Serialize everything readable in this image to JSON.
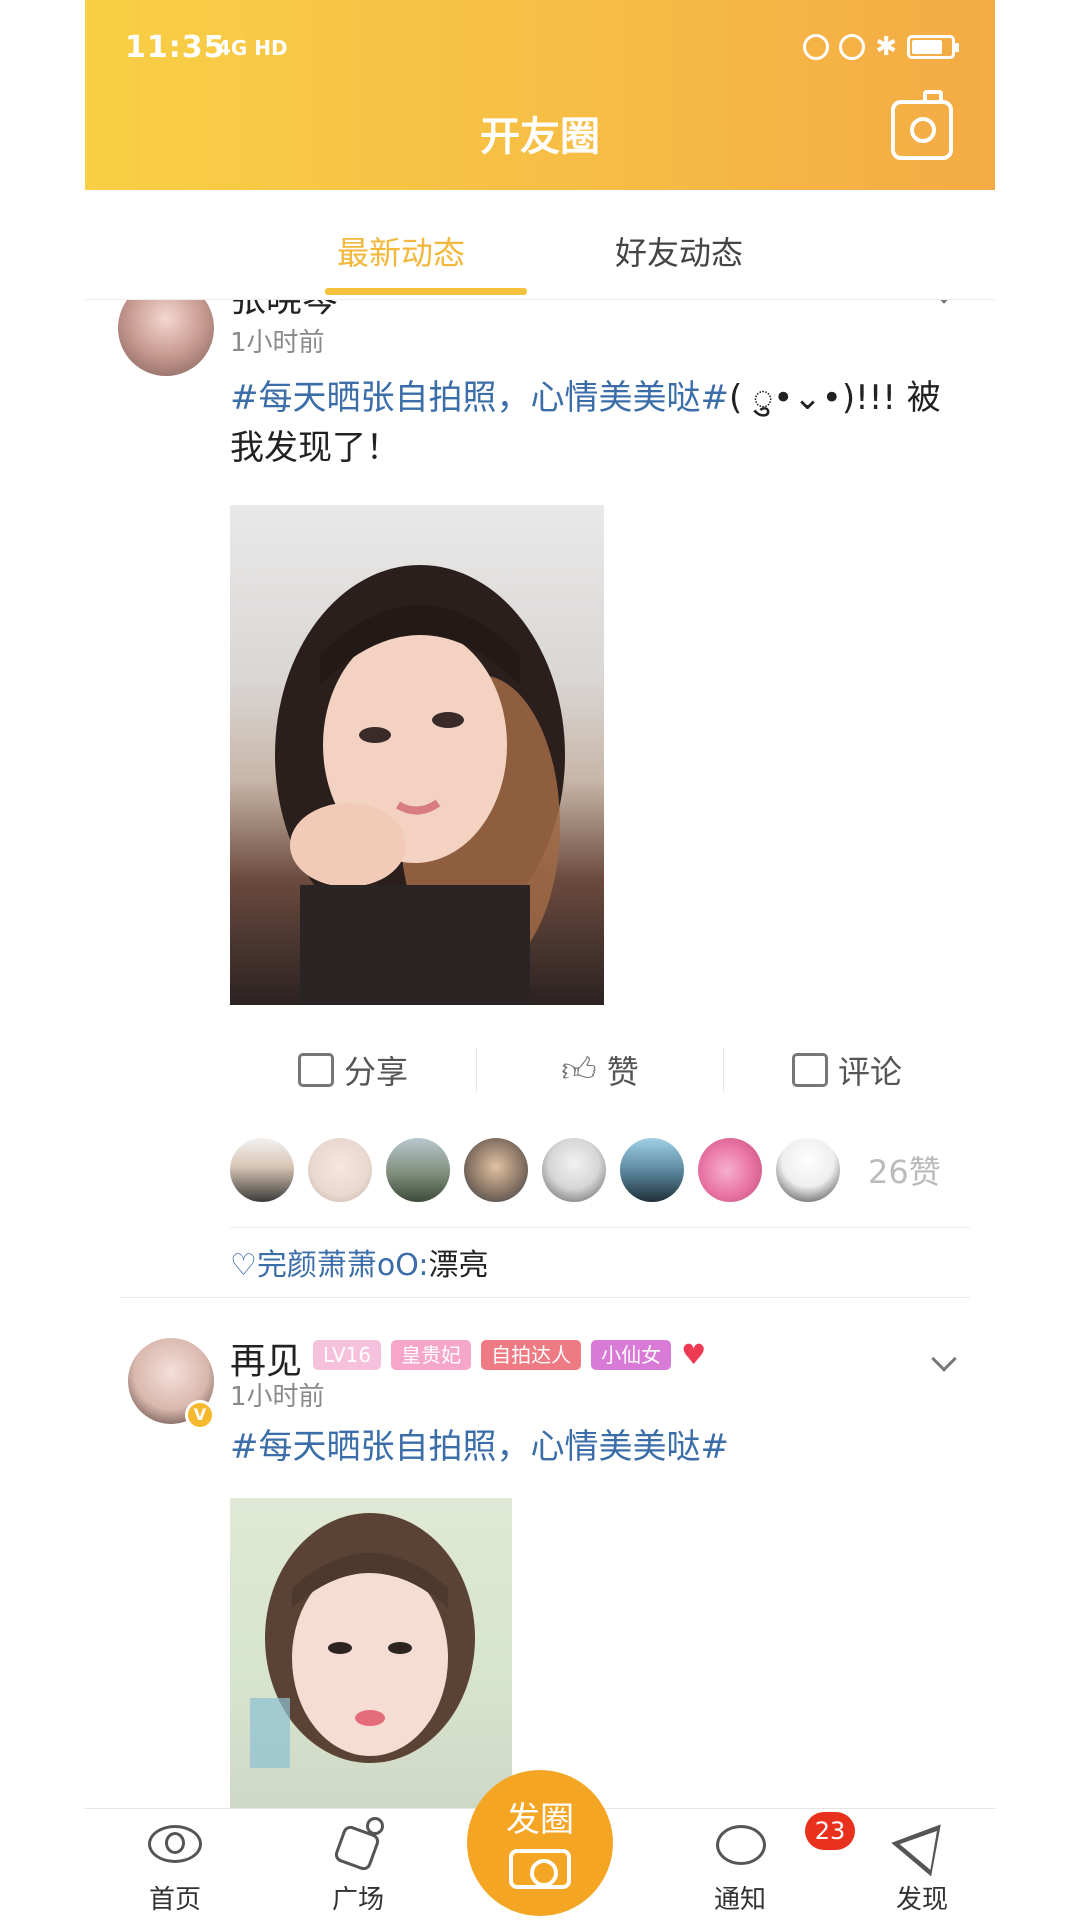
{
  "status_bar": {
    "time": "11:35",
    "network": "4G HD"
  },
  "header": {
    "title": "开友圈"
  },
  "tabs": [
    {
      "label": "最新动态"
    },
    {
      "label": "好友动态"
    }
  ],
  "posts": [
    {
      "name": "张晓琴",
      "time": "1小时前",
      "topic": "#每天晒张自拍照，心情美美哒#",
      "text": "( ु•⌄•)!!! 被我发现了！",
      "actions": {
        "share": "分享",
        "like": "赞",
        "comment": "评论"
      },
      "like_count": "26赞",
      "comment": {
        "who": "♡完颜萧萧oO:",
        "text": "漂亮"
      }
    },
    {
      "name": "再见",
      "time": "1小时前",
      "badges": [
        "LV16",
        "皇贵妃",
        "自拍达人",
        "小仙女"
      ],
      "topic": "#每天晒张自拍照，心情美美哒#"
    }
  ],
  "bottom_nav": {
    "home": "首页",
    "plaza": "广场",
    "post": "发圈",
    "notify": "通知",
    "notify_count": "23",
    "discover": "发现"
  },
  "colors": {
    "accent": "#f4c23c",
    "topic": "#3b6ea8",
    "fab": "#f5a524"
  }
}
